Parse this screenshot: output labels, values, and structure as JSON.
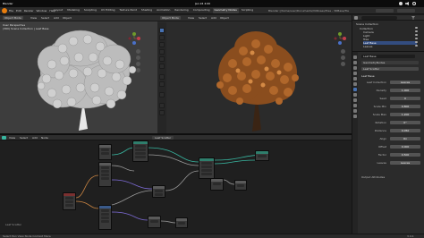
{
  "gnome_bar": {
    "activities": "Blender",
    "clock": "Jan 24  4:00",
    "status_icons": [
      "network-icon",
      "volume-icon",
      "power-icon"
    ]
  },
  "menubar": {
    "menus": [
      "File",
      "Edit",
      "Render",
      "Window",
      "Help"
    ],
    "workspaces": [
      "Layout",
      "Modeling",
      "Sculpting",
      "UV Editing",
      "Texture Paint",
      "Shading",
      "Animation",
      "Rendering",
      "Compositing",
      "Geometry Nodes",
      "Scripting"
    ],
    "active_workspace": "Geometry Nodes",
    "window_title": "Blender [/home/user/Documents/VXRoses/Tree - 3DBase/Tree.blend]"
  },
  "viewport_left": {
    "mode": "Object Mode",
    "menus": [
      "View",
      "Select",
      "Add",
      "Object"
    ],
    "overlay_text_1": "User Perspective",
    "overlay_text_2": "(360) Scene Collection | Leaf Base"
  },
  "viewport_right": {
    "mode": "Object Mode",
    "menus": [
      "View",
      "Select",
      "Add",
      "Object"
    ]
  },
  "node_editor": {
    "menus": [
      "View",
      "Select",
      "Add",
      "Node"
    ],
    "tree_name": "Leaf Scatter"
  },
  "outliner": {
    "title": "Scene Collection",
    "items": [
      "Collection",
      "Camera",
      "Light",
      "Tree",
      "Leaf Base",
      "Leaves"
    ]
  },
  "properties": {
    "object_name": "Leaf Base",
    "modifier_name": "GeometryNodes",
    "node_group": "Leaf Scatter",
    "section_title": "Leaf Base",
    "fields": [
      {
        "label": "Leaf Collection",
        "value": "Leaves"
      },
      {
        "label": "Density",
        "value": "1.000"
      },
      {
        "label": "Seed",
        "value": "0"
      },
      {
        "label": "Scale Min",
        "value": "0.800"
      },
      {
        "label": "Scale Max",
        "value": "1.200"
      },
      {
        "label": "Rotation",
        "value": "0°"
      },
      {
        "label": "Distance",
        "value": "0.050"
      },
      {
        "label": "Align",
        "value": "On"
      },
      {
        "label": "Offset",
        "value": "0.000"
      },
      {
        "label": "Factor",
        "value": "0.500"
      },
      {
        "label": "Leaves",
        "value": "Leaves"
      }
    ],
    "footer_label": "Output Attributes"
  },
  "statusbar": {
    "left": "Select  Pan View  Node Context Menu",
    "right": "3.4.1"
  },
  "colors": {
    "accent": "#4772b3",
    "link_teal": "#38b6a0",
    "link_orange": "#c98442",
    "link_purple": "#7d6bd6",
    "link_gray": "#9a9a9a",
    "foliage_autumn": "#b0672b"
  }
}
